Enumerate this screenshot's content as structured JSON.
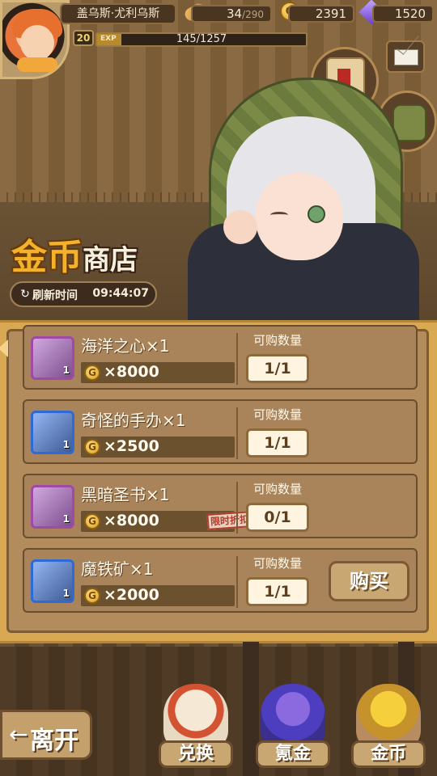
{
  "player": {
    "name": "盖乌斯·尤利乌斯",
    "level": "20",
    "exp_tag": "EXP",
    "exp_text": "145/1257",
    "exp_fraction": 0.115
  },
  "resources": {
    "stamina": {
      "current": "34",
      "max": "/290"
    },
    "gold": {
      "icon_text": "G",
      "value": "2391"
    },
    "gems": {
      "value": "1520"
    }
  },
  "shop": {
    "title_gold": "金币",
    "title_store": "商店",
    "refresh_label": "刷新时间",
    "refresh_time": "09:44:07",
    "refresh_icon": "↻"
  },
  "items": [
    {
      "name": "海洋之心×1",
      "price": "×8000",
      "coin": "G",
      "qty_label": "可购数量",
      "qty": "1/1",
      "icon_qty": "1",
      "frame": "purple"
    },
    {
      "name": "奇怪的手办×1",
      "price": "×2500",
      "coin": "G",
      "qty_label": "可购数量",
      "qty": "1/1",
      "icon_qty": "1",
      "frame": "blue"
    },
    {
      "name": "黑暗圣书×1",
      "price": "×8000",
      "coin": "G",
      "qty_label": "可购数量",
      "qty": "0/1",
      "icon_qty": "1",
      "frame": "purple",
      "discount": "限时折扣"
    },
    {
      "name": "魔铁矿×1",
      "price": "×2000",
      "coin": "G",
      "qty_label": "可购数量",
      "qty": "1/1",
      "icon_qty": "1",
      "frame": "blue",
      "buy_label": "购买"
    }
  ],
  "bottom": {
    "leave_arrow": "←",
    "leave_label": "离开",
    "exchange_label": "兑换",
    "krypton_label": "氪金",
    "gold_label": "金币"
  },
  "colors": {
    "gold_text": "#f3b22a",
    "panel": "#d8a852",
    "purple_frame": "#a14aa5",
    "blue_frame": "#2d6ad5"
  }
}
